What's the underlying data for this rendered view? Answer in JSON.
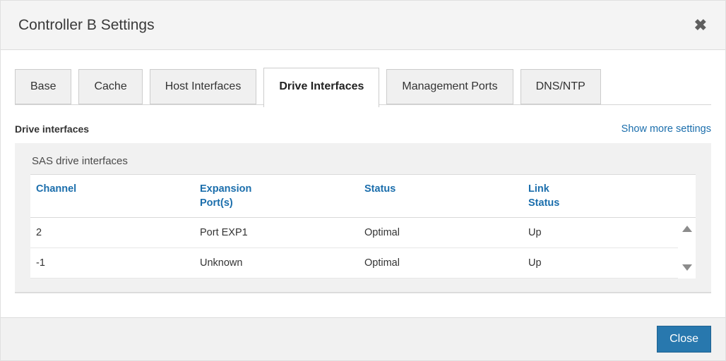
{
  "dialog": {
    "title": "Controller B Settings"
  },
  "icons": {
    "close": "✖"
  },
  "tabs": [
    {
      "label": "Base",
      "active": false
    },
    {
      "label": "Cache",
      "active": false
    },
    {
      "label": "Host Interfaces",
      "active": false
    },
    {
      "label": "Drive Interfaces",
      "active": true
    },
    {
      "label": "Management Ports",
      "active": false
    },
    {
      "label": "DNS/NTP",
      "active": false
    }
  ],
  "section": {
    "heading": "Drive interfaces",
    "link": "Show more settings"
  },
  "panel": {
    "title": "SAS drive interfaces",
    "table": {
      "columns": [
        "Channel",
        "Expansion\nPort(s)",
        "Status",
        "Link\nStatus"
      ],
      "rows": [
        {
          "channel": "2",
          "expansion_ports": "Port EXP1",
          "status": "Optimal",
          "link_status": "Up"
        },
        {
          "channel": "-1",
          "expansion_ports": "Unknown",
          "status": "Optimal",
          "link_status": "Up"
        }
      ]
    }
  },
  "footer": {
    "close_label": "Close"
  },
  "colors": {
    "accent_blue": "#1b6eac",
    "button_blue": "#2878ae",
    "panel_gray": "#f1f1f1",
    "header_gray": "#f4f4f4"
  }
}
